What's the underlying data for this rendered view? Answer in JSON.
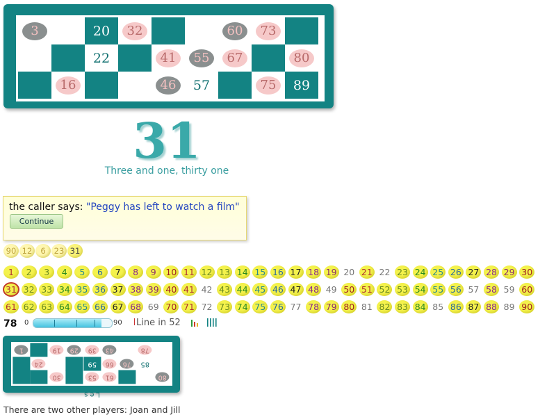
{
  "ticket": {
    "rows": [
      [
        {
          "n": "3",
          "s": "grey"
        },
        {
          "n": "",
          "s": "empty"
        },
        {
          "n": "20",
          "s": "teal"
        },
        {
          "n": "32",
          "s": "pink"
        },
        {
          "n": "",
          "s": "tealblank"
        },
        {
          "n": "",
          "s": "empty"
        },
        {
          "n": "60",
          "s": "grey"
        },
        {
          "n": "73",
          "s": "pink"
        },
        {
          "n": "",
          "s": "tealblank"
        }
      ],
      [
        {
          "n": "",
          "s": "empty"
        },
        {
          "n": "",
          "s": "tealblank"
        },
        {
          "n": "22",
          "s": "plain"
        },
        {
          "n": "",
          "s": "tealblank"
        },
        {
          "n": "41",
          "s": "pink"
        },
        {
          "n": "55",
          "s": "grey"
        },
        {
          "n": "67",
          "s": "pink"
        },
        {
          "n": "",
          "s": "tealblank"
        },
        {
          "n": "80",
          "s": "pink"
        }
      ],
      [
        {
          "n": "",
          "s": "tealblank"
        },
        {
          "n": "16",
          "s": "pink"
        },
        {
          "n": "",
          "s": "tealblank"
        },
        {
          "n": "",
          "s": "empty"
        },
        {
          "n": "46",
          "s": "grey"
        },
        {
          "n": "57",
          "s": "plain"
        },
        {
          "n": "",
          "s": "tealblank"
        },
        {
          "n": "75",
          "s": "pink"
        },
        {
          "n": "89",
          "s": "teal"
        }
      ]
    ]
  },
  "call": {
    "number": "31",
    "rhyme": "Three and one, thirty one"
  },
  "caller": {
    "prefix": "the caller says: ",
    "quote": "\"Peggy has left to watch a film\"",
    "continue_label": "Continue"
  },
  "recent_calls": [
    "90",
    "12",
    "6",
    "23",
    "31"
  ],
  "board": {
    "numbers": [
      {
        "n": "1",
        "c": true,
        "col": "#b03030"
      },
      {
        "n": "2",
        "c": true,
        "col": "#6a8a20"
      },
      {
        "n": "3",
        "c": true,
        "col": "#6a8a20"
      },
      {
        "n": "4",
        "c": true,
        "col": "#2a8a20"
      },
      {
        "n": "5",
        "c": true,
        "col": "#2a8a8a"
      },
      {
        "n": "6",
        "c": true,
        "col": "#2a6a9a"
      },
      {
        "n": "7",
        "c": true,
        "col": "#222222"
      },
      {
        "n": "8",
        "c": true,
        "col": "#8a2a8a"
      },
      {
        "n": "9",
        "c": true,
        "col": "#8a2a6a"
      },
      {
        "n": "10",
        "c": true,
        "col": "#a02020"
      },
      {
        "n": "11",
        "c": true,
        "col": "#b03030"
      },
      {
        "n": "12",
        "c": true,
        "col": "#6a8a20"
      },
      {
        "n": "13",
        "c": true,
        "col": "#6a8a20"
      },
      {
        "n": "14",
        "c": true,
        "col": "#2a8a20"
      },
      {
        "n": "15",
        "c": true,
        "col": "#2a8a8a"
      },
      {
        "n": "16",
        "c": true,
        "col": "#2a6a9a"
      },
      {
        "n": "17",
        "c": true,
        "col": "#222222"
      },
      {
        "n": "18",
        "c": true,
        "col": "#8a2a8a"
      },
      {
        "n": "19",
        "c": true,
        "col": "#8a2a6a"
      },
      {
        "n": "20",
        "c": false,
        "col": "#777777"
      },
      {
        "n": "21",
        "c": true,
        "col": "#b03030"
      },
      {
        "n": "22",
        "c": false,
        "col": "#777777"
      },
      {
        "n": "23",
        "c": true,
        "col": "#6a8a20"
      },
      {
        "n": "24",
        "c": true,
        "col": "#2a8a20"
      },
      {
        "n": "25",
        "c": true,
        "col": "#2a8a8a"
      },
      {
        "n": "26",
        "c": true,
        "col": "#2a6a9a"
      },
      {
        "n": "27",
        "c": true,
        "col": "#222222"
      },
      {
        "n": "28",
        "c": true,
        "col": "#8a2a8a"
      },
      {
        "n": "29",
        "c": true,
        "col": "#8a2a6a"
      },
      {
        "n": "30",
        "c": true,
        "col": "#a02020"
      },
      {
        "n": "31",
        "c": true,
        "col": "#b03030",
        "cur": true
      },
      {
        "n": "32",
        "c": true,
        "col": "#6a8a20"
      },
      {
        "n": "33",
        "c": true,
        "col": "#6a8a20"
      },
      {
        "n": "34",
        "c": true,
        "col": "#2a8a20"
      },
      {
        "n": "35",
        "c": true,
        "col": "#2a8a8a"
      },
      {
        "n": "36",
        "c": true,
        "col": "#2a6a9a"
      },
      {
        "n": "37",
        "c": true,
        "col": "#222222"
      },
      {
        "n": "38",
        "c": true,
        "col": "#8a2a8a"
      },
      {
        "n": "39",
        "c": true,
        "col": "#8a2a6a"
      },
      {
        "n": "40",
        "c": true,
        "col": "#a02020"
      },
      {
        "n": "41",
        "c": true,
        "col": "#b03030"
      },
      {
        "n": "42",
        "c": false,
        "col": "#777777"
      },
      {
        "n": "43",
        "c": true,
        "col": "#6a8a20"
      },
      {
        "n": "44",
        "c": true,
        "col": "#2a8a20"
      },
      {
        "n": "45",
        "c": true,
        "col": "#2a8a8a"
      },
      {
        "n": "46",
        "c": true,
        "col": "#2a6a9a"
      },
      {
        "n": "47",
        "c": true,
        "col": "#222222"
      },
      {
        "n": "48",
        "c": true,
        "col": "#8a2a8a"
      },
      {
        "n": "49",
        "c": false,
        "col": "#777777"
      },
      {
        "n": "50",
        "c": true,
        "col": "#a02020"
      },
      {
        "n": "51",
        "c": true,
        "col": "#b03030"
      },
      {
        "n": "52",
        "c": true,
        "col": "#6a8a20"
      },
      {
        "n": "53",
        "c": true,
        "col": "#6a8a20"
      },
      {
        "n": "54",
        "c": true,
        "col": "#2a8a20"
      },
      {
        "n": "55",
        "c": true,
        "col": "#2a8a8a"
      },
      {
        "n": "56",
        "c": true,
        "col": "#2a6a9a"
      },
      {
        "n": "57",
        "c": false,
        "col": "#777777"
      },
      {
        "n": "58",
        "c": true,
        "col": "#8a2a8a"
      },
      {
        "n": "59",
        "c": false,
        "col": "#777777"
      },
      {
        "n": "60",
        "c": true,
        "col": "#a02020"
      },
      {
        "n": "61",
        "c": true,
        "col": "#b03030"
      },
      {
        "n": "62",
        "c": true,
        "col": "#6a8a20"
      },
      {
        "n": "63",
        "c": true,
        "col": "#6a8a20"
      },
      {
        "n": "64",
        "c": true,
        "col": "#2a8a20"
      },
      {
        "n": "65",
        "c": true,
        "col": "#2a8a8a"
      },
      {
        "n": "66",
        "c": true,
        "col": "#2a6a9a"
      },
      {
        "n": "67",
        "c": true,
        "col": "#222222"
      },
      {
        "n": "68",
        "c": true,
        "col": "#8a2a8a"
      },
      {
        "n": "69",
        "c": false,
        "col": "#777777"
      },
      {
        "n": "70",
        "c": true,
        "col": "#a02020"
      },
      {
        "n": "71",
        "c": true,
        "col": "#b03030"
      },
      {
        "n": "72",
        "c": false,
        "col": "#777777"
      },
      {
        "n": "73",
        "c": true,
        "col": "#6a8a20"
      },
      {
        "n": "74",
        "c": true,
        "col": "#2a8a20"
      },
      {
        "n": "75",
        "c": true,
        "col": "#2a8a8a"
      },
      {
        "n": "76",
        "c": true,
        "col": "#2a6a9a"
      },
      {
        "n": "77",
        "c": false,
        "col": "#777777"
      },
      {
        "n": "78",
        "c": true,
        "col": "#8a2a8a"
      },
      {
        "n": "79",
        "c": true,
        "col": "#8a2a6a"
      },
      {
        "n": "80",
        "c": true,
        "col": "#a02020"
      },
      {
        "n": "81",
        "c": false,
        "col": "#777777"
      },
      {
        "n": "82",
        "c": true,
        "col": "#6a8a20"
      },
      {
        "n": "83",
        "c": true,
        "col": "#6a8a20"
      },
      {
        "n": "84",
        "c": true,
        "col": "#2a8a20"
      },
      {
        "n": "85",
        "c": false,
        "col": "#777777"
      },
      {
        "n": "86",
        "c": true,
        "col": "#2a6a9a"
      },
      {
        "n": "87",
        "c": true,
        "col": "#222222"
      },
      {
        "n": "88",
        "c": true,
        "col": "#8a2a8a"
      },
      {
        "n": "89",
        "c": false,
        "col": "#777777"
      },
      {
        "n": "90",
        "c": true,
        "col": "#a02020"
      }
    ]
  },
  "progress": {
    "count": "78",
    "min": "0",
    "max": "90",
    "fraction": 0.867,
    "line_label": "Line in 52"
  },
  "other_ticket": {
    "rows": [
      [
        {
          "n": "1",
          "s": "grey"
        },
        {
          "n": "",
          "s": "tealblank"
        },
        {
          "n": "19",
          "s": "pink"
        },
        {
          "n": "29",
          "s": "grey"
        },
        {
          "n": "39",
          "s": "pink"
        },
        {
          "n": "43",
          "s": "grey"
        },
        {
          "n": "",
          "s": "empty"
        },
        {
          "n": "78",
          "s": "pink"
        },
        {
          "n": "",
          "s": "empty"
        }
      ],
      [
        {
          "n": "",
          "s": "tealblank"
        },
        {
          "n": "24",
          "s": "pink"
        },
        {
          "n": "",
          "s": "empty"
        },
        {
          "n": "",
          "s": "tealblank"
        },
        {
          "n": "59",
          "s": "teal"
        },
        {
          "n": "66",
          "s": "pink"
        },
        {
          "n": "76",
          "s": "grey"
        },
        {
          "n": "85",
          "s": "plain"
        },
        {
          "n": "",
          "s": "empty"
        }
      ],
      [
        {
          "n": "",
          "s": "tealblank"
        },
        {
          "n": "",
          "s": "tealblank"
        },
        {
          "n": "30",
          "s": "pink"
        },
        {
          "n": "",
          "s": "tealblank"
        },
        {
          "n": "53",
          "s": "pink"
        },
        {
          "n": "61",
          "s": "pink"
        },
        {
          "n": "",
          "s": "tealblank"
        },
        {
          "n": "",
          "s": "empty"
        },
        {
          "n": "80",
          "s": "grey"
        }
      ]
    ],
    "label": "Les"
  },
  "footer": "There are two other players: Joan and Jill",
  "colors": {
    "teal": "#138383",
    "pink": "#f6c9c9",
    "grey": "#8a8f8f",
    "ball": "#f4f24c"
  }
}
